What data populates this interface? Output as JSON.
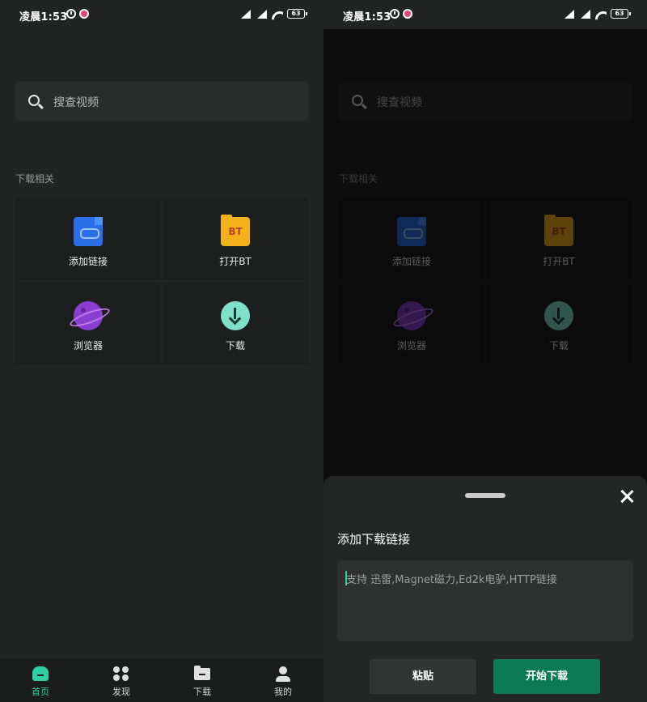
{
  "status_bar": {
    "time": "凌晨1:53",
    "battery": "63"
  },
  "home": {
    "search": {
      "placeholder": "搜查视频",
      "icon": "search-icon"
    },
    "section_title": "下载相关",
    "grid": [
      {
        "label": "添加链接",
        "icon": "link-file-icon",
        "color": "#2a6fe8"
      },
      {
        "label": "打开BT",
        "icon": "bt-folder-icon",
        "color": "#f3b11c",
        "badge": "BT"
      },
      {
        "label": "浏览器",
        "icon": "planet-icon",
        "color": "#8a3fd1"
      },
      {
        "label": "下载",
        "icon": "download-arrow-icon",
        "color": "#7ee0c8"
      }
    ],
    "bottom_nav": [
      {
        "label": "首页",
        "icon": "home-icon",
        "active": true
      },
      {
        "label": "发现",
        "icon": "discover-icon",
        "active": false
      },
      {
        "label": "下载",
        "icon": "folder-icon",
        "active": false
      },
      {
        "label": "我的",
        "icon": "user-icon",
        "active": false
      }
    ]
  },
  "sheet": {
    "title": "添加下载链接",
    "input_placeholder": "支持 迅雷,Magnet磁力,Ed2k电驴,HTTP链接",
    "paste_label": "粘贴",
    "start_label": "开始下载"
  },
  "colors": {
    "background": "#222423",
    "accent": "#2fd0a2",
    "primary_button": "#0b7a55"
  }
}
